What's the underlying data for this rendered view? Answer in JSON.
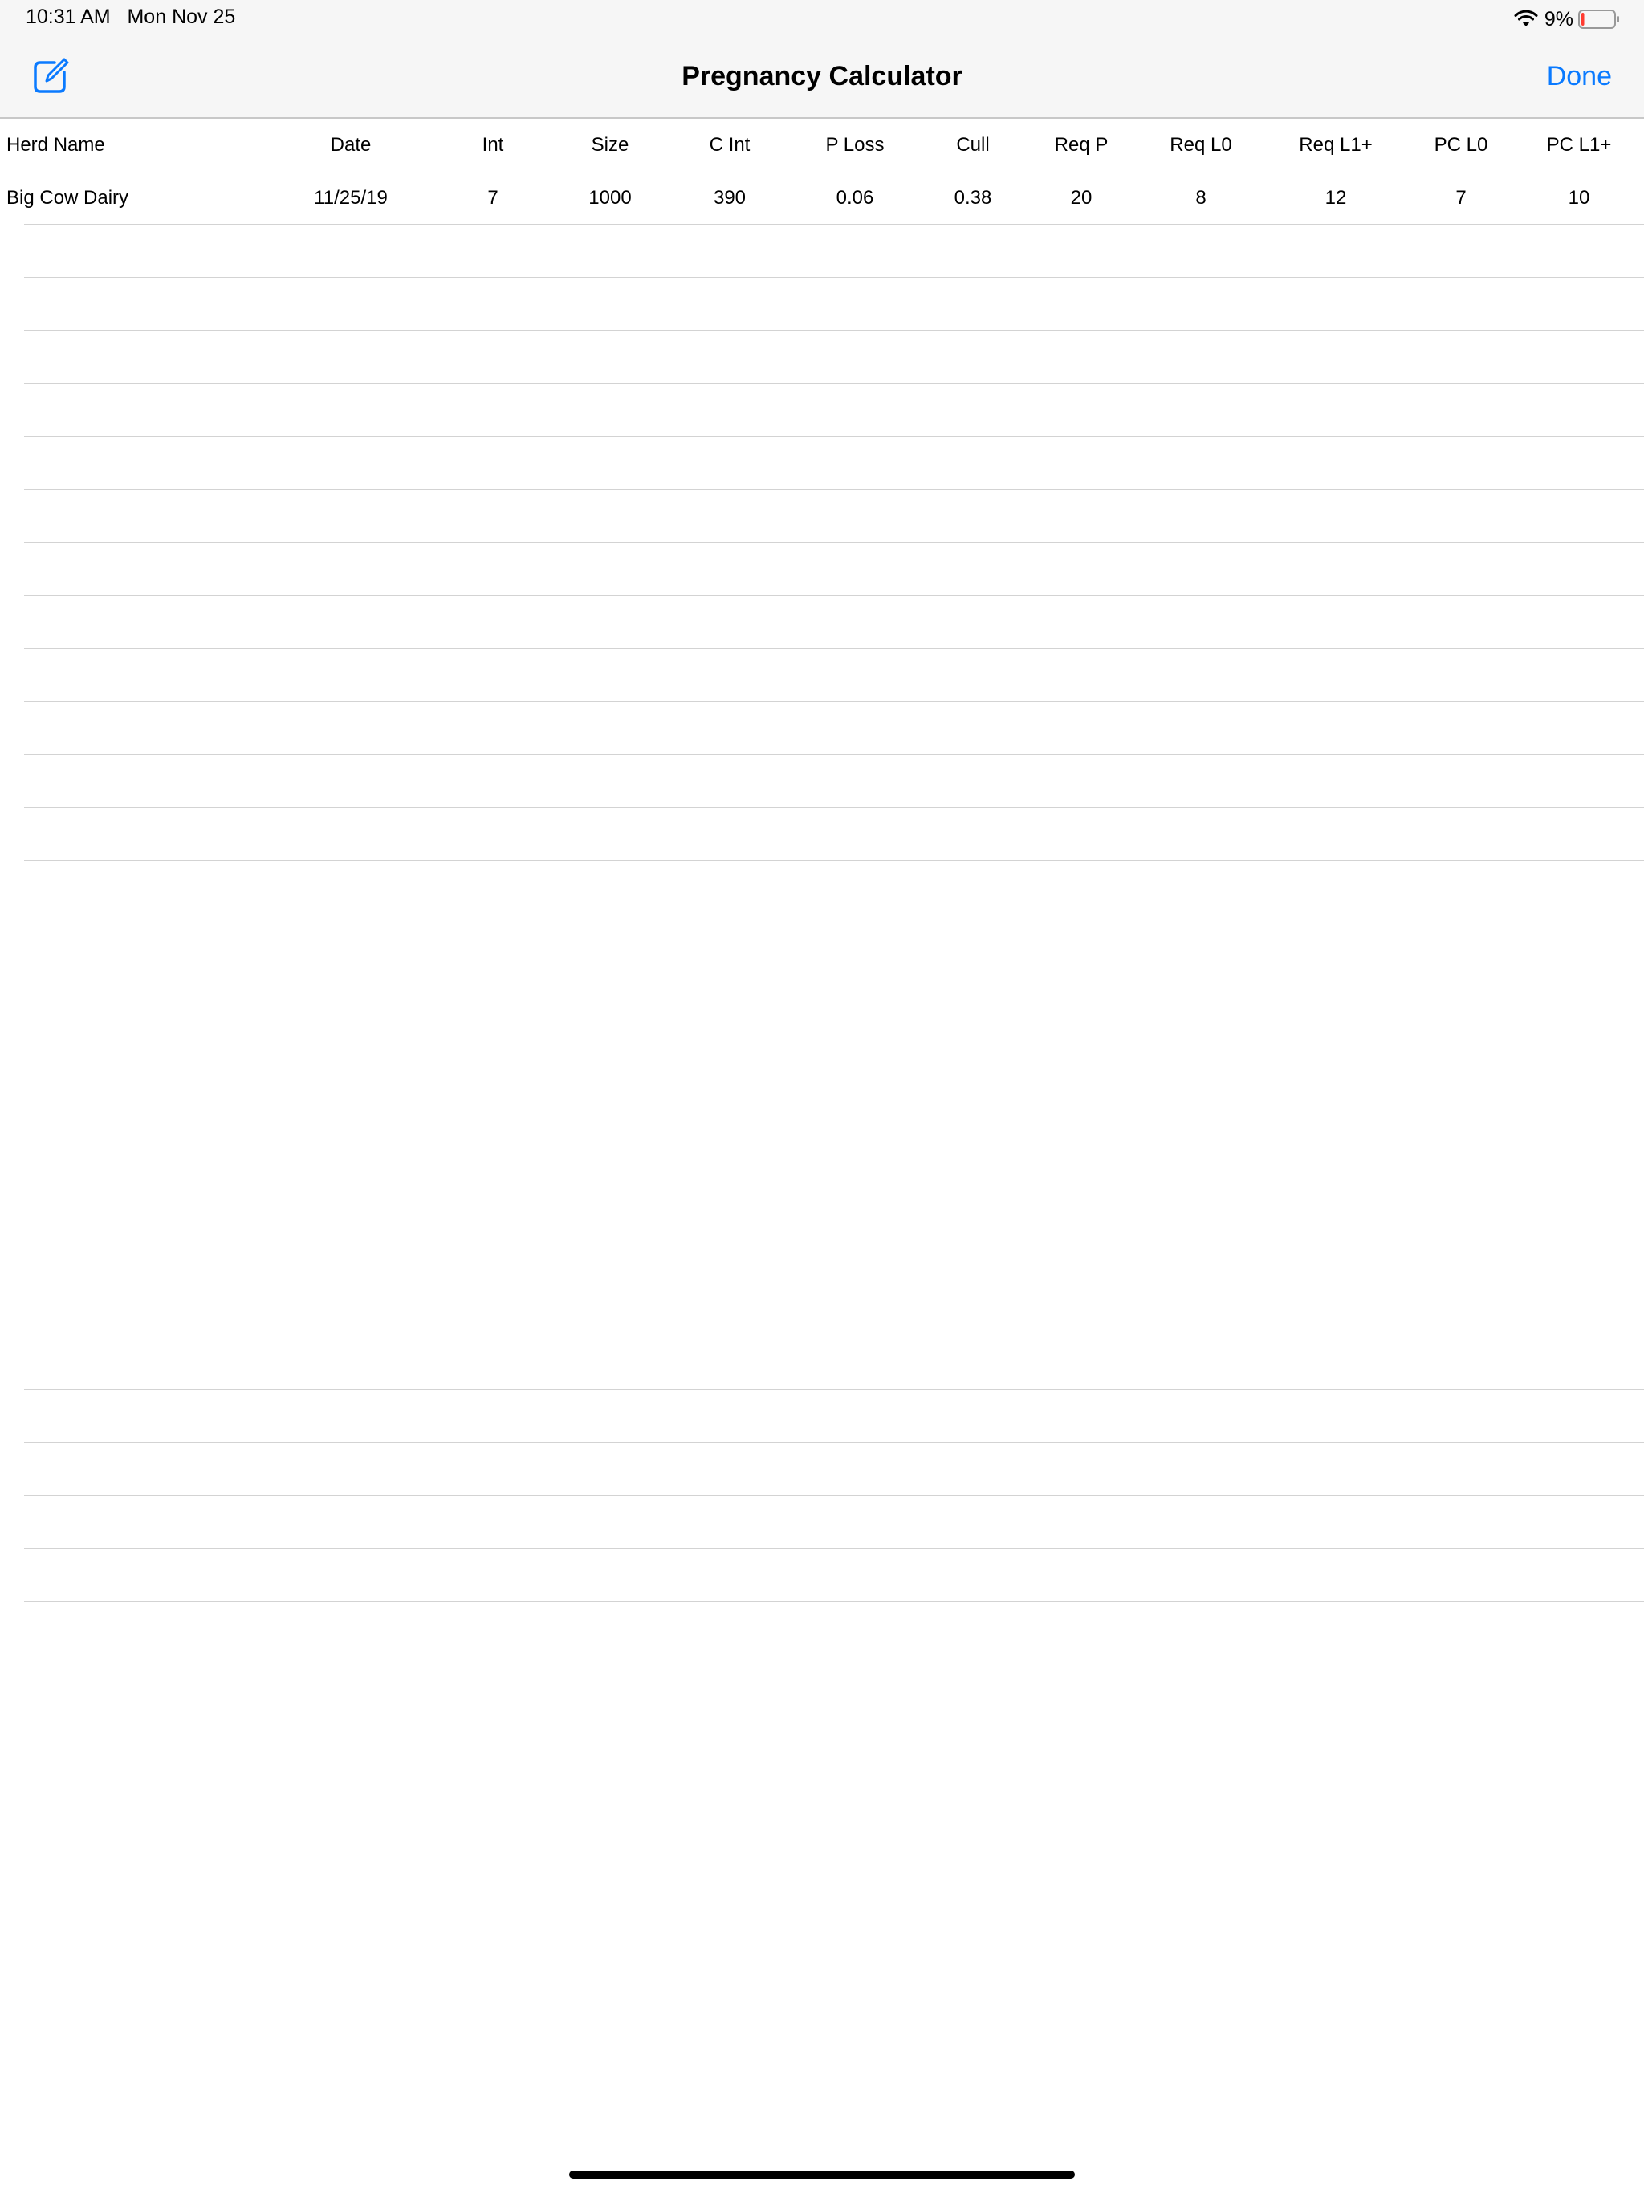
{
  "status_bar": {
    "time": "10:31 AM",
    "date": "Mon Nov 25",
    "battery_percent": "9%",
    "battery_level": 0.09,
    "battery_color": "#ff3b30"
  },
  "nav": {
    "title": "Pregnancy Calculator",
    "done_label": "Done",
    "compose_icon": "compose-icon",
    "accent_color": "#0a7aff"
  },
  "table": {
    "columns": [
      "Herd Name",
      "Date",
      "Int",
      "Size",
      "C Int",
      "P Loss",
      "Cull",
      "Req P",
      "Req L0",
      "Req L1+",
      "PC L0",
      "PC L1+"
    ],
    "rows": [
      [
        "Big Cow Dairy",
        "11/25/19",
        "7",
        "1000",
        "390",
        "0.06",
        "0.38",
        "20",
        "8",
        "12",
        "7",
        "10"
      ]
    ]
  }
}
